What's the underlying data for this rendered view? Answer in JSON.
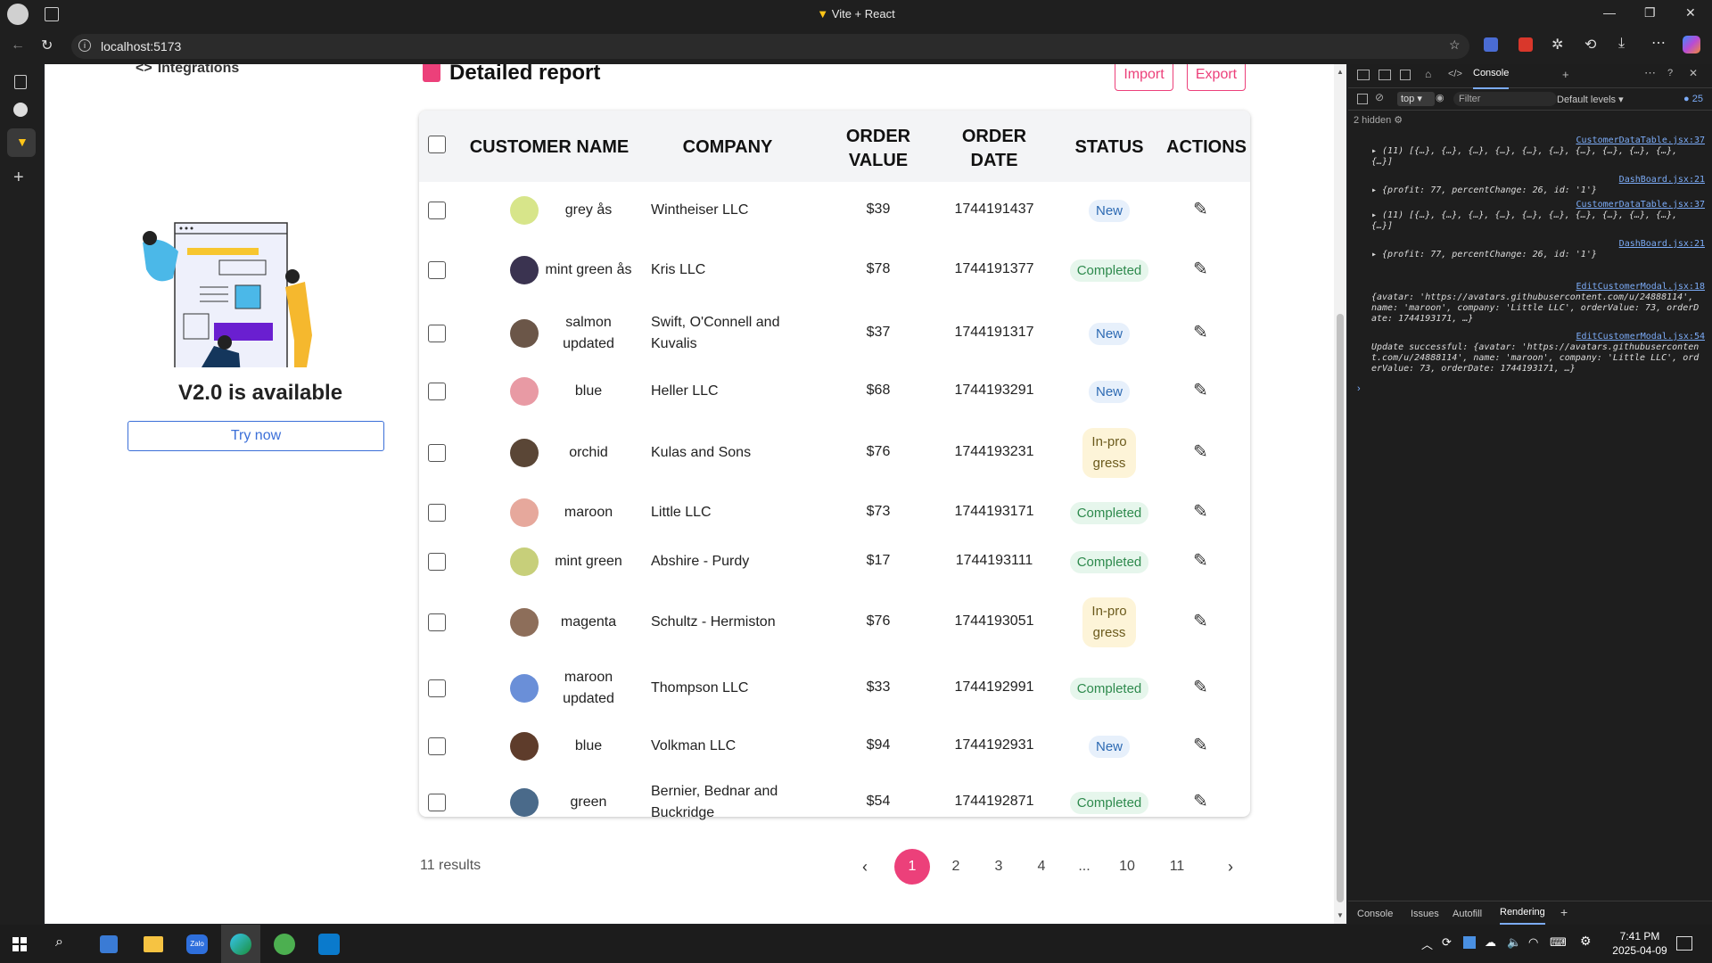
{
  "browser": {
    "window_title": "Vite + React",
    "url": "localhost:5173"
  },
  "sidebar_card": {
    "nav_label": "Integrations",
    "heading": "V2.0 is available",
    "button_label": "Try now"
  },
  "report": {
    "title": "Detailed report",
    "import_label": "Import",
    "export_label": "Export",
    "columns": [
      "CUSTOMER NAME",
      "COMPANY",
      "ORDER VALUE",
      "ORDER DATE",
      "STATUS",
      "ACTIONS"
    ],
    "rows": [
      {
        "name": "grey ås",
        "company": "Wintheiser LLC",
        "value": "$39",
        "date": "1744191437",
        "status": "New",
        "avatar_color": "#d7e58a"
      },
      {
        "name": "mint green ås",
        "company": "Kris LLC",
        "value": "$78",
        "date": "1744191377",
        "status": "Completed",
        "avatar_color": "#3a3350"
      },
      {
        "name": "salmon updated",
        "company": "Swift, O'Connell and Kuvalis",
        "value": "$37",
        "date": "1744191317",
        "status": "New",
        "avatar_color": "#6b5648"
      },
      {
        "name": "blue",
        "company": "Heller LLC",
        "value": "$68",
        "date": "1744193291",
        "status": "New",
        "avatar_color": "#e89aa4"
      },
      {
        "name": "orchid",
        "company": "Kulas and Sons",
        "value": "$76",
        "date": "1744193231",
        "status": "In-progress",
        "avatar_color": "#5a4636"
      },
      {
        "name": "maroon",
        "company": "Little LLC",
        "value": "$73",
        "date": "1744193171",
        "status": "Completed",
        "avatar_color": "#e6a89c"
      },
      {
        "name": "mint green",
        "company": "Abshire - Purdy",
        "value": "$17",
        "date": "1744193111",
        "status": "Completed",
        "avatar_color": "#c7cf7a"
      },
      {
        "name": "magenta",
        "company": "Schultz - Hermiston",
        "value": "$76",
        "date": "1744193051",
        "status": "In-progress",
        "avatar_color": "#8d6e5a"
      },
      {
        "name": "maroon updated",
        "company": "Thompson LLC",
        "value": "$33",
        "date": "1744192991",
        "status": "Completed",
        "avatar_color": "#6a8fd8"
      },
      {
        "name": "blue",
        "company": "Volkman LLC",
        "value": "$94",
        "date": "1744192931",
        "status": "New",
        "avatar_color": "#5e3c2b"
      },
      {
        "name": "green",
        "company": "Bernier, Bednar and Buckridge",
        "value": "$54",
        "date": "1744192871",
        "status": "Completed",
        "avatar_color": "#4a6a8a"
      }
    ],
    "results_label": "11 results",
    "pages": [
      "1",
      "2",
      "3",
      "4",
      "...",
      "10",
      "11"
    ],
    "active_page": "1"
  },
  "devtools": {
    "tabs": [
      "Console"
    ],
    "context": "top",
    "filter_placeholder": "Filter",
    "levels": "Default levels",
    "issue_count": "25",
    "hidden_label": "2 hidden",
    "logs": [
      {
        "source": "CustomerDataTable.jsx:37",
        "text": "▸ (11) [{…}, {…}, {…}, {…}, {…}, {…}, {…}, {…}, {…}, {…}, {…}]"
      },
      {
        "source": "DashBoard.jsx:21",
        "text": "▸ {profit: 77, percentChange: 26, id: '1'}"
      },
      {
        "source": "CustomerDataTable.jsx:37",
        "text": "▸ (11) [{…}, {…}, {…}, {…}, {…}, {…}, {…}, {…}, {…}, {…}, {…}]"
      },
      {
        "source": "DashBoard.jsx:21",
        "text": "▸ {profit: 77, percentChange: 26, id: '1'}"
      },
      {
        "source": "EditCustomerModal.jsx:18",
        "text": "{avatar: 'https://avatars.githubusercontent.com/u/24888114', name: 'maroon', company: 'Little LLC', orderValue: 73, orderDate: 1744193171, …}"
      },
      {
        "source": "EditCustomerModal.jsx:54",
        "text": "Update successful: {avatar: 'https://avatars.githubusercontent.com/u/24888114', name: 'maroon', company: 'Little LLC', orderValue: 73, orderDate: 1744193171, …}"
      }
    ],
    "bottom_tabs": [
      "Console",
      "Issues",
      "Autofill",
      "Rendering"
    ]
  },
  "taskbar": {
    "time": "7:41 PM",
    "date": "2025-04-09"
  },
  "colors": {
    "accent": "#ec407a",
    "page_bg": "#ffffff"
  }
}
